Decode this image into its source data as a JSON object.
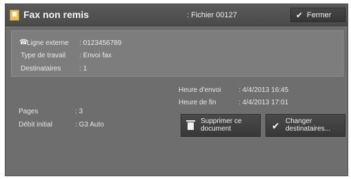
{
  "title": "Fax non remis",
  "file": ": Fichier 00127",
  "close_button": "Fermer",
  "info": {
    "ligne_label": "Ligne externe",
    "ligne_value": ": 0123456789",
    "type_label": "Type de travail",
    "type_value": ": Envoi fax",
    "dest_label": "Destinataires",
    "dest_value": ": 1"
  },
  "times": {
    "envoi_label": "Heure d'envoi",
    "envoi_value": ": 4/4/2013 16:45",
    "fin_label": "Heure de fin",
    "fin_value": ": 4/4/2013 17:01"
  },
  "details": {
    "pages_label": "Pages",
    "pages_value": ": 3",
    "debit_label": "Débit initial",
    "debit_value": ": G3 Auto"
  },
  "buttons": {
    "delete_line1": "Supprimer ce",
    "delete_line2": "document",
    "change_line1": "Changer",
    "change_line2": "destinataires..."
  },
  "colors": {
    "panel": "#6e6e6e",
    "infobox": "#7d7d7d",
    "button": "#404040",
    "icon_yellow": "#e2c466"
  },
  "icons": [
    "document-icon",
    "check-icon",
    "phone-line-icon",
    "trash-icon"
  ]
}
